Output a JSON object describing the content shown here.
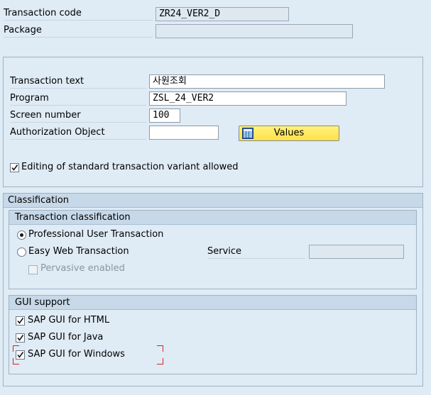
{
  "header": {
    "transaction_code_label": "Transaction code",
    "transaction_code_value": "ZR24_VER2_D",
    "package_label": "Package",
    "package_value": ""
  },
  "details": {
    "transaction_text_label": "Transaction text",
    "transaction_text_value": "사원조회",
    "program_label": "Program",
    "program_value": "ZSL_24_VER2",
    "screen_number_label": "Screen number",
    "screen_number_value": "100",
    "auth_object_label": "Authorization Object",
    "auth_object_value": "",
    "values_button_label": "Values",
    "values_button_icon": "table-values-icon",
    "variant_allowed_label": "Editing of standard transaction variant allowed",
    "variant_allowed_checked": true
  },
  "classification": {
    "title": "Classification",
    "transaction_classification": {
      "title": "Transaction classification",
      "professional_label": "Professional User Transaction",
      "professional_selected": true,
      "easy_web_label": "Easy Web Transaction",
      "easy_web_selected": false,
      "service_label": "Service",
      "service_value": "",
      "pervasive_label": "Pervasive enabled",
      "pervasive_checked": false
    },
    "gui_support": {
      "title": "GUI support",
      "html_label": "SAP GUI for HTML",
      "html_checked": true,
      "java_label": "SAP GUI for Java",
      "java_checked": true,
      "windows_label": "SAP GUI for Windows",
      "windows_checked": true
    }
  },
  "colors": {
    "background": "#dfebf5",
    "frame_header": "#c7d8e8",
    "button_yellow": "#ffe14a",
    "focus_marker": "#dd2222"
  }
}
